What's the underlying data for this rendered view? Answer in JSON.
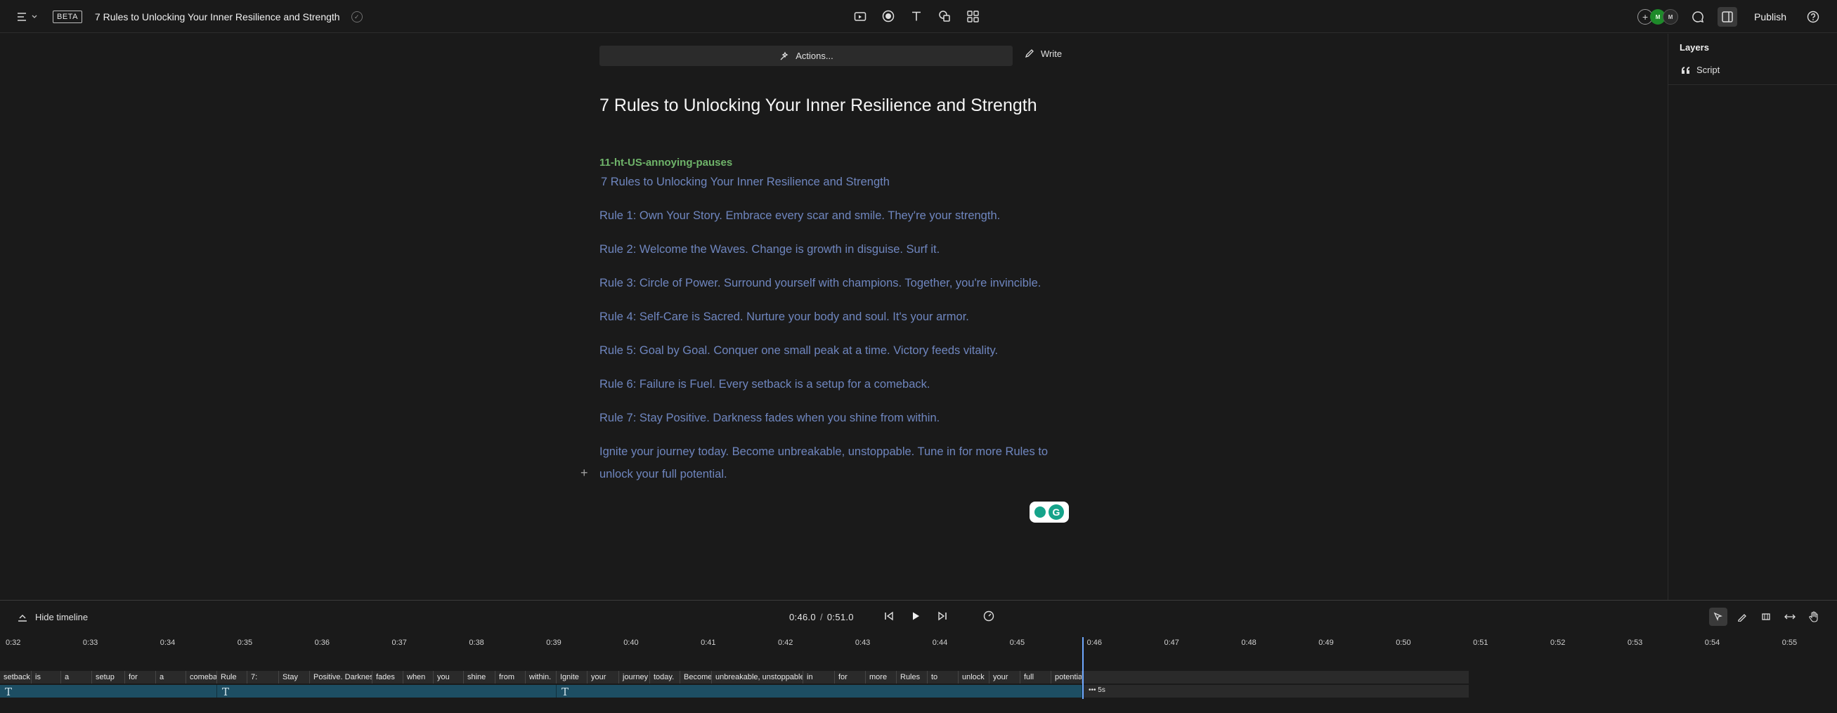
{
  "header": {
    "beta_label": "BETA",
    "doc_title": "7 Rules to Unlocking Your Inner Resilience and Strength",
    "avatars": [
      "M",
      "M"
    ],
    "publish_label": "Publish"
  },
  "layers": {
    "heading": "Layers",
    "items": [
      {
        "label": "Script",
        "icon": "quote-icon"
      }
    ]
  },
  "editor": {
    "actions_label": "Actions...",
    "write_label": "Write",
    "title": "7 Rules to Unlocking Your Inner Resilience and Strength",
    "speaker": "11-ht-US-annoying-pauses",
    "subtitle": "7 Rules to Unlocking Your Inner Resilience and Strength",
    "lines": [
      "Rule 1: Own Your Story. Embrace every scar and smile. They're your strength.",
      "Rule 2: Welcome the Waves. Change is growth in disguise. Surf it.",
      "Rule 3: Circle of Power. Surround yourself with champions. Together, you're invincible.",
      "Rule 4: Self-Care is Sacred. Nurture your body and soul. It's your armor.",
      "Rule 5: Goal by Goal. Conquer one small peak at a time. Victory feeds vitality.",
      "Rule 6: Failure is Fuel. Every setback is a setup for a comeback.",
      "Rule 7: Stay Positive. Darkness fades when you shine from within.",
      "Ignite your journey today. Become unbreakable, unstoppable. Tune in for more Rules to",
      "unlock your full potential."
    ]
  },
  "timeline": {
    "hide_label": "Hide timeline",
    "current_time": "0:46.0",
    "separator": "/",
    "total_time": "0:51.0",
    "ticks": [
      "0:32",
      "0:33",
      "0:34",
      "0:35",
      "0:36",
      "0:37",
      "0:38",
      "0:39",
      "0:40",
      "0:41",
      "0:42",
      "0:43",
      "0:44",
      "0:45",
      "0:46",
      "0:47",
      "0:48",
      "0:49",
      "0:50",
      "0:51",
      "0:52",
      "0:53",
      "0:54",
      "0:55"
    ],
    "words": [
      "setback",
      "is",
      "a",
      "setup",
      "for",
      "a",
      "comeback.",
      "Rule",
      "7:",
      "Stay",
      "Positive. Darkness",
      "fades",
      "when",
      "you",
      "shine",
      "from",
      "within.",
      "Ignite",
      "your",
      "journey",
      "today.",
      "Become",
      "unbreakable, unstoppable.",
      "in",
      "for",
      "more",
      "Rules",
      "to",
      "unlock",
      "your",
      "full",
      "potential."
    ],
    "clip_more_label": "••• 5s",
    "accent_color": "#1d4e63",
    "playhead_color": "#6fa8ff"
  }
}
